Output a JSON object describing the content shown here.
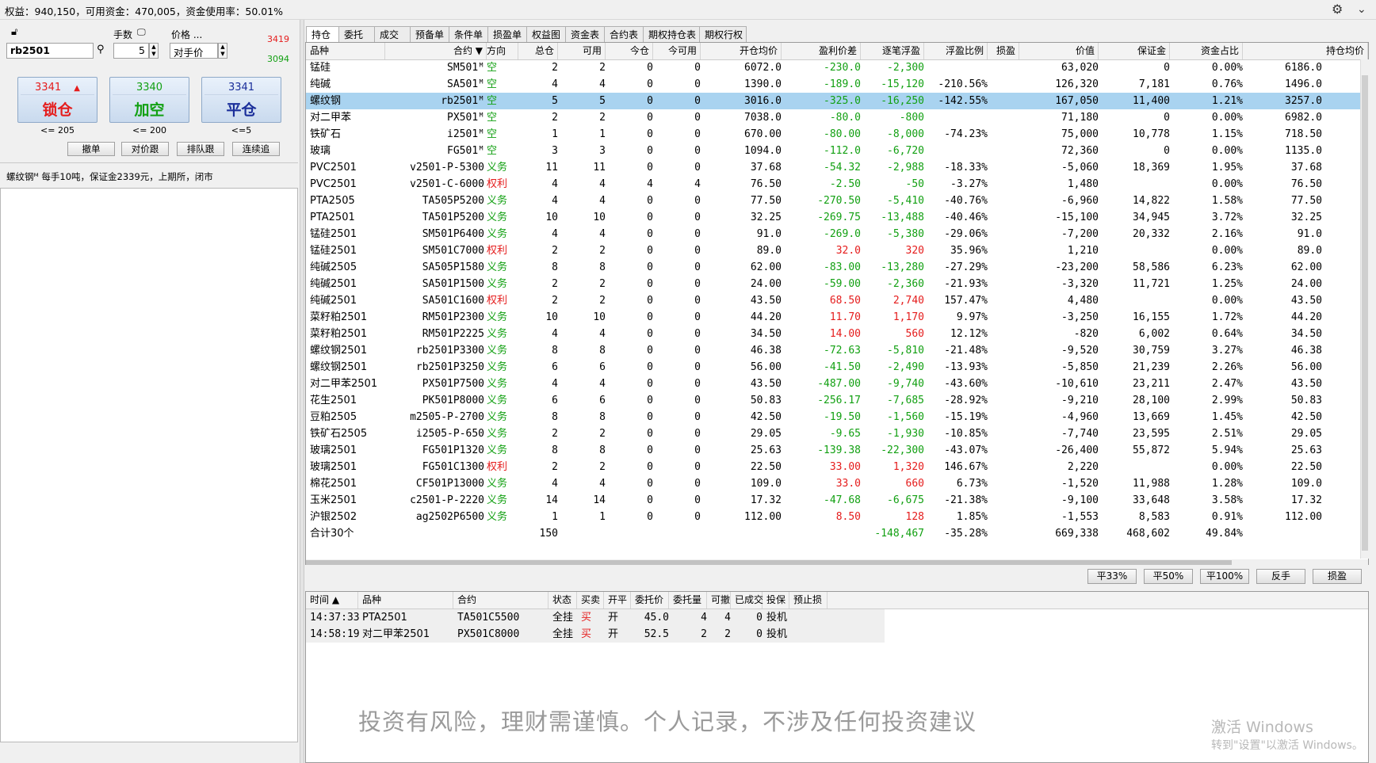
{
  "account": {
    "status_text": "权益：940,150，可用资金：470,005，资金使用率：50.01%"
  },
  "order_panel": {
    "lots_label": "手数",
    "price_label": "价格 ...",
    "contract_value": "rb2501",
    "lots_value": "5",
    "price_type_value": "对手价",
    "ask_price": "3419",
    "bid_price": "3094",
    "buttons": [
      {
        "price": "3341",
        "text": "锁仓",
        "limit": "<= 205",
        "price_color": "#e51c1c",
        "text_color": "#e51c1c"
      },
      {
        "price": "3340",
        "text": "加空",
        "limit": "<= 200",
        "price_color": "#12a012",
        "text_color": "#12a012"
      },
      {
        "price": "3341",
        "text": "平仓",
        "limit": "<=5",
        "price_color": "#1a2e9a",
        "text_color": "#1a2e9a"
      }
    ],
    "small_buttons": [
      "撤单",
      "对价跟",
      "排队跟",
      "连续追"
    ],
    "contract_info": "螺纹钢ᴹ 每手10吨，保证金2339元，上期所，闭市"
  },
  "tabs": [
    "持仓",
    "委托",
    "成交",
    "预备单",
    "条件单",
    "损盈单",
    "权益图",
    "资金表",
    "合约表",
    "期权持仓表",
    "期权行权"
  ],
  "positions": {
    "columns": [
      "品种",
      "合约",
      "方向",
      "总仓",
      "可用",
      "今仓",
      "今可用",
      "开仓均价",
      "盈利价差",
      "逐笔浮盈",
      "浮盈比例",
      "损盈",
      "价值",
      "保证金",
      "资金占比",
      "持仓均价"
    ],
    "rows": [
      [
        "锰硅",
        "SM501ᴹ",
        "空",
        "2",
        "2",
        "0",
        "0",
        "6072.0",
        "-230.0",
        "-2,300",
        "",
        "",
        "63,020",
        "0",
        "0.00%",
        "6186.0"
      ],
      [
        "纯碱",
        "SA501ᴹ",
        "空",
        "4",
        "4",
        "0",
        "0",
        "1390.0",
        "-189.0",
        "-15,120",
        "-210.56%",
        "",
        "126,320",
        "7,181",
        "0.76%",
        "1496.0"
      ],
      [
        "螺纹钢",
        "rb2501ᴹ",
        "空",
        "5",
        "5",
        "0",
        "0",
        "3016.0",
        "-325.0",
        "-16,250",
        "-142.55%",
        "",
        "167,050",
        "11,400",
        "1.21%",
        "3257.0"
      ],
      [
        "对二甲苯",
        "PX501ᴹ",
        "空",
        "2",
        "2",
        "0",
        "0",
        "7038.0",
        "-80.0",
        "-800",
        "",
        "",
        "71,180",
        "0",
        "0.00%",
        "6982.0"
      ],
      [
        "铁矿石",
        "i2501ᴹ",
        "空",
        "1",
        "1",
        "0",
        "0",
        "670.00",
        "-80.00",
        "-8,000",
        "-74.23%",
        "",
        "75,000",
        "10,778",
        "1.15%",
        "718.50"
      ],
      [
        "玻璃",
        "FG501ᴹ",
        "空",
        "3",
        "3",
        "0",
        "0",
        "1094.0",
        "-112.0",
        "-6,720",
        "",
        "",
        "72,360",
        "0",
        "0.00%",
        "1135.0"
      ],
      [
        "PVC2501",
        "v2501-P-5300",
        "义务",
        "11",
        "11",
        "0",
        "0",
        "37.68",
        "-54.32",
        "-2,988",
        "-18.33%",
        "",
        "-5,060",
        "18,369",
        "1.95%",
        "37.68"
      ],
      [
        "PVC2501",
        "v2501-C-6000",
        "权利",
        "4",
        "4",
        "4",
        "4",
        "76.50",
        "-2.50",
        "-50",
        "-3.27%",
        "",
        "1,480",
        "",
        "0.00%",
        "76.50"
      ],
      [
        "PTA2505",
        "TA505P5200",
        "义务",
        "4",
        "4",
        "0",
        "0",
        "77.50",
        "-270.50",
        "-5,410",
        "-40.76%",
        "",
        "-6,960",
        "14,822",
        "1.58%",
        "77.50"
      ],
      [
        "PTA2501",
        "TA501P5200",
        "义务",
        "10",
        "10",
        "0",
        "0",
        "32.25",
        "-269.75",
        "-13,488",
        "-40.46%",
        "",
        "-15,100",
        "34,945",
        "3.72%",
        "32.25"
      ],
      [
        "锰硅2501",
        "SM501P6400",
        "义务",
        "4",
        "4",
        "0",
        "0",
        "91.0",
        "-269.0",
        "-5,380",
        "-29.06%",
        "",
        "-7,200",
        "20,332",
        "2.16%",
        "91.0"
      ],
      [
        "锰硅2501",
        "SM501C7000",
        "权利",
        "2",
        "2",
        "0",
        "0",
        "89.0",
        "32.0",
        "320",
        "35.96%",
        "",
        "1,210",
        "",
        "0.00%",
        "89.0"
      ],
      [
        "纯碱2505",
        "SA505P1580",
        "义务",
        "8",
        "8",
        "0",
        "0",
        "62.00",
        "-83.00",
        "-13,280",
        "-27.29%",
        "",
        "-23,200",
        "58,586",
        "6.23%",
        "62.00"
      ],
      [
        "纯碱2501",
        "SA501P1500",
        "义务",
        "2",
        "2",
        "0",
        "0",
        "24.00",
        "-59.00",
        "-2,360",
        "-21.93%",
        "",
        "-3,320",
        "11,721",
        "1.25%",
        "24.00"
      ],
      [
        "纯碱2501",
        "SA501C1600",
        "权利",
        "2",
        "2",
        "0",
        "0",
        "43.50",
        "68.50",
        "2,740",
        "157.47%",
        "",
        "4,480",
        "",
        "0.00%",
        "43.50"
      ],
      [
        "菜籽粕2501",
        "RM501P2300",
        "义务",
        "10",
        "10",
        "0",
        "0",
        "44.20",
        "11.70",
        "1,170",
        "9.97%",
        "",
        "-3,250",
        "16,155",
        "1.72%",
        "44.20"
      ],
      [
        "菜籽粕2501",
        "RM501P2225",
        "义务",
        "4",
        "4",
        "0",
        "0",
        "34.50",
        "14.00",
        "560",
        "12.12%",
        "",
        "-820",
        "6,002",
        "0.64%",
        "34.50"
      ],
      [
        "螺纹钢2501",
        "rb2501P3300",
        "义务",
        "8",
        "8",
        "0",
        "0",
        "46.38",
        "-72.63",
        "-5,810",
        "-21.48%",
        "",
        "-9,520",
        "30,759",
        "3.27%",
        "46.38"
      ],
      [
        "螺纹钢2501",
        "rb2501P3250",
        "义务",
        "6",
        "6",
        "0",
        "0",
        "56.00",
        "-41.50",
        "-2,490",
        "-13.93%",
        "",
        "-5,850",
        "21,239",
        "2.26%",
        "56.00"
      ],
      [
        "对二甲苯2501",
        "PX501P7500",
        "义务",
        "4",
        "4",
        "0",
        "0",
        "43.50",
        "-487.00",
        "-9,740",
        "-43.60%",
        "",
        "-10,610",
        "23,211",
        "2.47%",
        "43.50"
      ],
      [
        "花生2501",
        "PK501P8000",
        "义务",
        "6",
        "6",
        "0",
        "0",
        "50.83",
        "-256.17",
        "-7,685",
        "-28.92%",
        "",
        "-9,210",
        "28,100",
        "2.99%",
        "50.83"
      ],
      [
        "豆粕2505",
        "m2505-P-2700",
        "义务",
        "8",
        "8",
        "0",
        "0",
        "42.50",
        "-19.50",
        "-1,560",
        "-15.19%",
        "",
        "-4,960",
        "13,669",
        "1.45%",
        "42.50"
      ],
      [
        "铁矿石2505",
        "i2505-P-650",
        "义务",
        "2",
        "2",
        "0",
        "0",
        "29.05",
        "-9.65",
        "-1,930",
        "-10.85%",
        "",
        "-7,740",
        "23,595",
        "2.51%",
        "29.05"
      ],
      [
        "玻璃2501",
        "FG501P1320",
        "义务",
        "8",
        "8",
        "0",
        "0",
        "25.63",
        "-139.38",
        "-22,300",
        "-43.07%",
        "",
        "-26,400",
        "55,872",
        "5.94%",
        "25.63"
      ],
      [
        "玻璃2501",
        "FG501C1300",
        "权利",
        "2",
        "2",
        "0",
        "0",
        "22.50",
        "33.00",
        "1,320",
        "146.67%",
        "",
        "2,220",
        "",
        "0.00%",
        "22.50"
      ],
      [
        "棉花2501",
        "CF501P13000",
        "义务",
        "4",
        "4",
        "0",
        "0",
        "109.0",
        "33.0",
        "660",
        "6.73%",
        "",
        "-1,520",
        "11,988",
        "1.28%",
        "109.0"
      ],
      [
        "玉米2501",
        "c2501-P-2220",
        "义务",
        "14",
        "14",
        "0",
        "0",
        "17.32",
        "-47.68",
        "-6,675",
        "-21.38%",
        "",
        "-9,100",
        "33,648",
        "3.58%",
        "17.32"
      ],
      [
        "沪银2502",
        "ag2502P6500",
        "义务",
        "1",
        "1",
        "0",
        "0",
        "112.00",
        "8.50",
        "128",
        "1.85%",
        "",
        "-1,553",
        "8,583",
        "0.91%",
        "112.00"
      ]
    ],
    "total": [
      "合计30个",
      "",
      "",
      "150",
      "",
      "",
      "",
      "",
      "",
      "-148,467",
      "-35.28%",
      "",
      "669,338",
      "468,602",
      "49.84%",
      ""
    ]
  },
  "actions": [
    "平33%",
    "平50%",
    "平100%",
    "反手",
    "损盈"
  ],
  "orders": {
    "columns": [
      "时间 ▲",
      "品种",
      "合约",
      "状态",
      "买卖",
      "开平",
      "委托价",
      "委托量",
      "可撤",
      "已成交",
      "投保",
      "预止损"
    ],
    "rows": [
      [
        "14:37:33",
        "PTA2501",
        "TA501C5500",
        "全挂",
        "买",
        "开",
        "45.0",
        "4",
        "4",
        "0",
        "投机",
        ""
      ],
      [
        "14:58:19",
        "对二甲苯2501",
        "PX501C8000",
        "全挂",
        "买",
        "开",
        "52.5",
        "2",
        "2",
        "0",
        "投机",
        ""
      ]
    ]
  },
  "disclaimer": "投资有风险，理财需谨慎。个人记录，不涉及任何投资建议",
  "watermark": {
    "line1": "激活 Windows",
    "line2": "转到\"设置\"以激活 Windows。"
  },
  "colors": {
    "up": "#e51c1c",
    "down": "#12a012",
    "selected_row": "#a9d3f0"
  }
}
